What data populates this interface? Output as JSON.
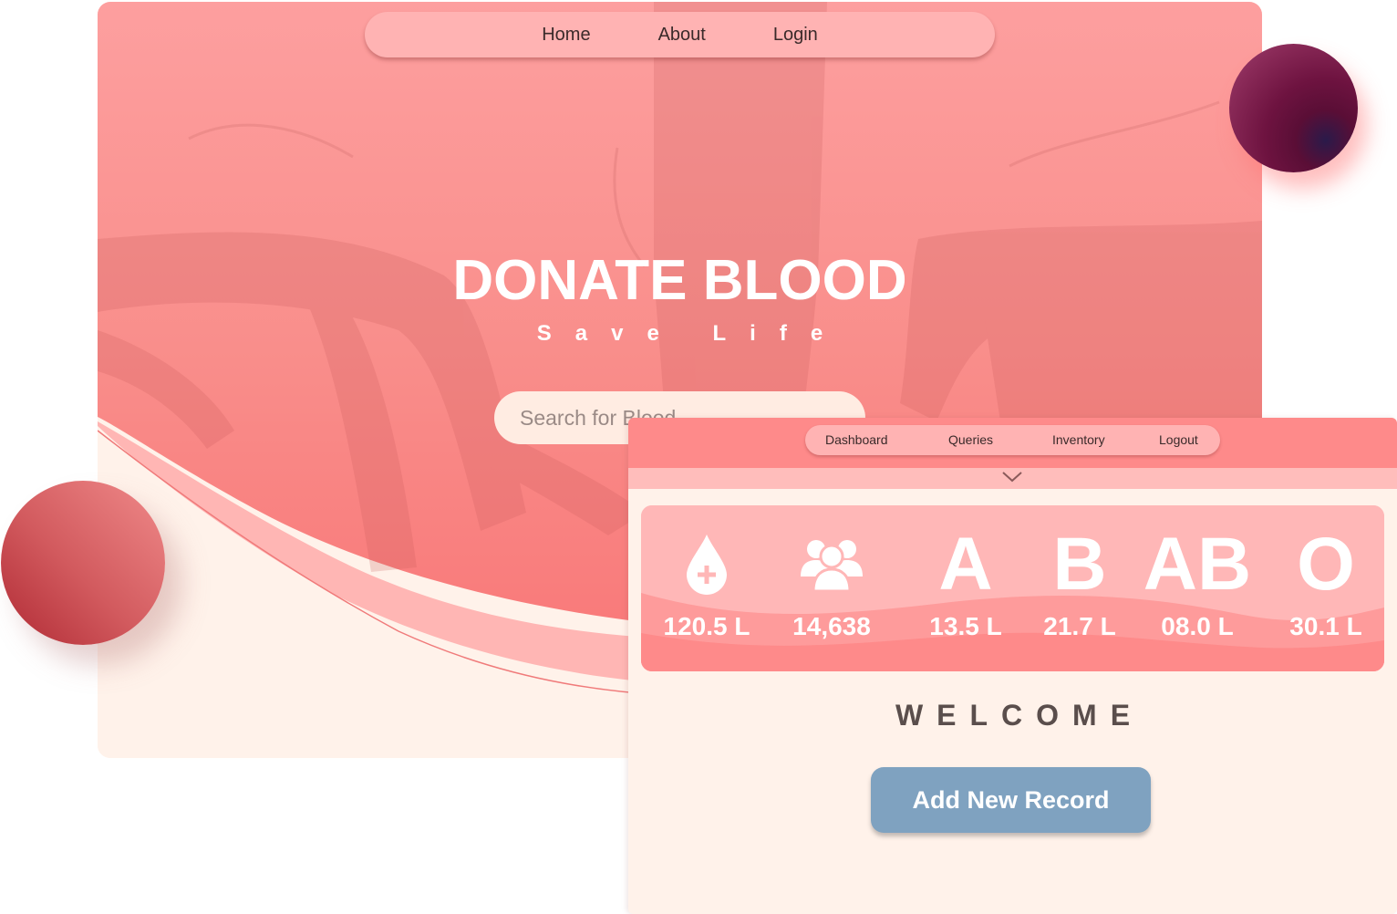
{
  "landing": {
    "nav": {
      "home": "Home",
      "about": "About",
      "login": "Login"
    },
    "title": "DONATE BLOOD",
    "subtitle": "Save Life",
    "search_placeholder": "Search for Blood"
  },
  "dashboard": {
    "nav": {
      "dashboard": "Dashboard",
      "queries": "Queries",
      "inventory": "Inventory",
      "logout": "Logout"
    },
    "stats": [
      {
        "label": "blood-drop-icon",
        "value": "120.5 L"
      },
      {
        "label": "donors-icon",
        "value": "14,638"
      },
      {
        "label": "A",
        "value": "13.5 L"
      },
      {
        "label": "B",
        "value": "21.7 L"
      },
      {
        "label": "AB",
        "value": "08.0 L"
      },
      {
        "label": "O",
        "value": "30.1 L"
      }
    ],
    "welcome": "WELCOME",
    "add_button": "Add New Record"
  },
  "colors": {
    "hero_pink": "#fb8f8c",
    "nav_pink": "#ffb3b3",
    "dash_header": "#fe8a8a",
    "card_bg": "#fff2ea",
    "button_blue": "#7fa2c0",
    "welcome_text": "#5a4e4c"
  }
}
